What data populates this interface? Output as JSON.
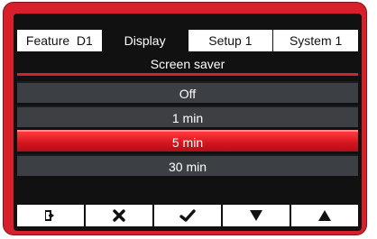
{
  "tabs": [
    {
      "label": "Feature  D1"
    },
    {
      "label": "Display"
    },
    {
      "label": "Setup 1"
    },
    {
      "label": "System 1"
    }
  ],
  "active_tab": "Display",
  "menu": {
    "title": "Screen saver",
    "options": [
      {
        "label": "Off"
      },
      {
        "label": "1 min"
      },
      {
        "label": "5 min"
      },
      {
        "label": "30 min"
      }
    ],
    "selected": "5 min"
  },
  "toolbar": [
    {
      "icon": "exit-icon"
    },
    {
      "icon": "cancel-icon"
    },
    {
      "icon": "confirm-icon"
    },
    {
      "icon": "down-arrow-icon"
    },
    {
      "icon": "up-arrow-icon"
    }
  ],
  "colors": {
    "accent": "#d7202c",
    "screen": "#111111",
    "option_bg": "#3c4045"
  }
}
